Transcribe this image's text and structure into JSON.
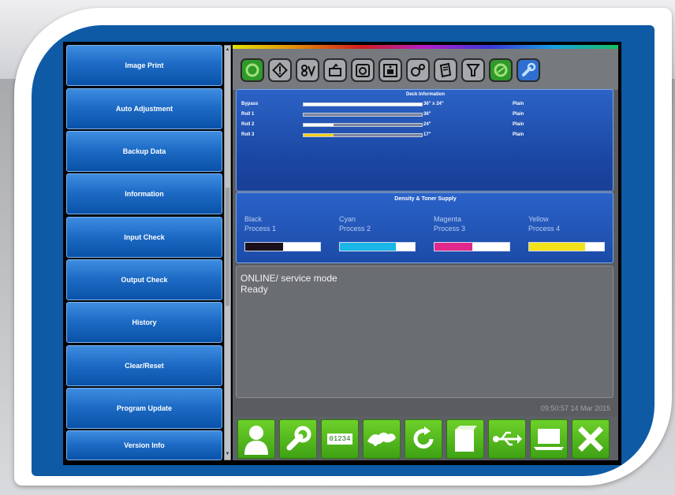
{
  "sidebar": {
    "items": [
      {
        "label": "Image Print"
      },
      {
        "label": "Auto Adjustment"
      },
      {
        "label": "Backup Data"
      },
      {
        "label": "Information"
      },
      {
        "label": "Input Check"
      },
      {
        "label": "Output Check"
      },
      {
        "label": "History"
      },
      {
        "label": "Clear/Reset"
      },
      {
        "label": "Program Update"
      },
      {
        "label": "Version Info"
      }
    ]
  },
  "toolbar": {
    "icons": [
      "power-icon",
      "warning-icon",
      "toner-icon",
      "paper-feed-icon",
      "scanner-icon",
      "stacker-icon",
      "gears-icon",
      "paper-stack-icon",
      "filter-icon",
      "eco-icon",
      "wrench-icon"
    ]
  },
  "deck": {
    "title": "Deck Information",
    "rows": [
      {
        "name": "Bypass",
        "size": "36\" x 24\"",
        "type": "Plain",
        "level": 1.0,
        "color": "#ffffff"
      },
      {
        "name": "Roll 1",
        "size": "36\"",
        "type": "Plain",
        "level": 0.0,
        "color": "#ffffff"
      },
      {
        "name": "Roll 2",
        "size": "24\"",
        "type": "Plain",
        "level": 0.25,
        "color": "#ffffff"
      },
      {
        "name": "Roll 3",
        "size": "17\"",
        "type": "Plain",
        "level": 0.25,
        "color": "#f2d21a"
      }
    ]
  },
  "density": {
    "title": "Density & Toner Supply",
    "toners": [
      {
        "name": "Black",
        "process": "Process 1",
        "level": 0.5,
        "color": "#1a0f1a"
      },
      {
        "name": "Cyan",
        "process": "Process 2",
        "level": 0.75,
        "color": "#1ab6e8"
      },
      {
        "name": "Magenta",
        "process": "Process 3",
        "level": 0.5,
        "color": "#e0288c"
      },
      {
        "name": "Yellow",
        "process": "Process 4",
        "level": 0.75,
        "color": "#f2e21a"
      }
    ]
  },
  "status": {
    "line1": "ONLINE/ service mode",
    "line2": "Ready"
  },
  "timestamp": "09:50:57 14 Mar 2015",
  "bottom_bar": {
    "counter_text": "01234",
    "icons": [
      "user-icon",
      "wrench-icon",
      "counter-icon",
      "network-icon",
      "refresh-icon",
      "paper-icon",
      "usb-icon",
      "laptop-icon",
      "close-icon"
    ]
  },
  "colors": {
    "frame_blue": "#0e5aa5",
    "button_blue": "#1e6cc6",
    "bottom_green": "#4cb41a"
  }
}
